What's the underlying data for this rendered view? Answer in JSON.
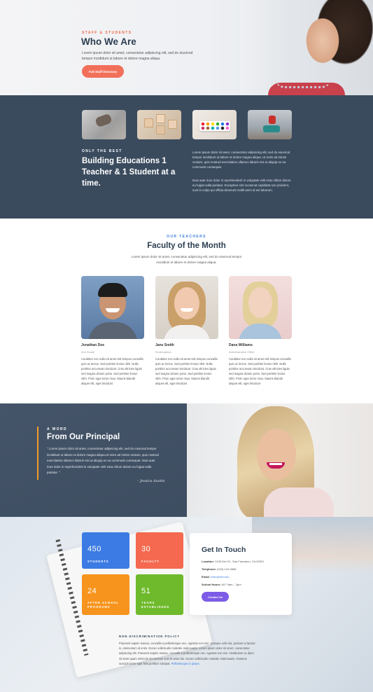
{
  "hero": {
    "eyebrow": "STAFF & STUDENTS",
    "title": "Who We Are",
    "text": "Lorem ipsum dolor sit amet, consectetur adipiscing elit, sed do eiusmod tempor incididunt ut labore et dolore magna aliqua.",
    "button": "Full Staff Directory"
  },
  "overview": {
    "eyebrow": "ONLY THE BEST",
    "title": "Building Educations 1 Teacher & 1 Student at a time.",
    "para1": "Lorem ipsum dolor sit amet, consectetur adipiscing elit, sed do eiusmod tempor incididunt ut labore et dolore magna aliqua. Ut enim ad minim veniam, quis nostrud exercitation ullamco laboris nisi ut aliquip ex ea commodo consequat.",
    "para2": "Duis aute irure dolor in reprehenderit in voluptate velit esse cillum dolore eu fugiat nulla pariatur. Excepteur sint occaecat cupidatat non proident, sunt in culpa qui officia deserunt mollit anim id est laborum."
  },
  "faculty": {
    "eyebrow": "OUR TEACHERS",
    "title": "Faculty of the Month",
    "intro": "Lorem ipsum dolor sit amet, consectetur adipiscing elit, sed do eiusmod tempor incididunt ut labore et dolore magna aliqua.",
    "members": [
      {
        "name": "Jonathan Doe",
        "role": "2nd Grade",
        "bio": "Curabitur non nulla sit amet nisl tempus convallis quis ac lectus. Sed porttitor lectus nibh. Nulla porttitor accumsan tincidunt. Cras ultricies ligula sed magna dictum porta. Sed porttitor lectus nibh. Proin eget tortor risus. Mauris blandit aliquet elit, eget tincidunt"
      },
      {
        "name": "Jane Smith",
        "role": "Kindergarten",
        "bio": "Curabitur non nulla sit amet nisl tempus convallis quis ac lectus. Sed porttitor lectus nibh. Nulla porttitor accumsan tincidunt. Cras ultricies ligula sed magna dictum porta. Sed porttitor lectus nibh. Proin eget tortor risus. Mauris blandit aliquet elit, eget tincidunt"
      },
      {
        "name": "Dana Williams",
        "role": "Administrative Office",
        "bio": "Curabitur non nulla sit amet nisl tempus convallis quis ac lectus. Sed porttitor lectus nibh. Nulla porttitor accumsan tincidunt. Cras ultricies ligula sed magna dictum porta. Sed porttitor lectus nibh. Proin eget tortor risus. Mauris blandit aliquet elit, eget tincidunt"
      }
    ]
  },
  "principal": {
    "eyebrow": "A WORD",
    "title": "From Our Principal",
    "quote": "\" Lorem ipsum dolor sit amet, consectetur adipiscing elit, sed do eiusmod tempor incididunt ut labore et dolore magna aliqua.Ut enim ad minim veniam, quis nostrud exercitation ullamco laboris nisi ut aliquip ex ea commodo consequat. Duis aute irure dolor in reprehenderit in voluptate velit esse cillum dolore eu fugiat nulla pariatur. \"",
    "signature": "– Jessica Austin"
  },
  "stats": [
    {
      "number": "450",
      "label": "STUDENTS",
      "color": "#3b7be3"
    },
    {
      "number": "30",
      "label": "FACULTY",
      "color": "#f4694f"
    },
    {
      "number": "24",
      "label": "AFTER SCHOOL PROGRAMS",
      "color": "#f7941d"
    },
    {
      "number": "51",
      "label": "YEARS ESTABLISHED",
      "color": "#6fba2c"
    }
  ],
  "contact": {
    "title": "Get In Touch",
    "location_label": "Location:",
    "location": "1245 Divi St., San Francisco, CA 92921",
    "phone_label": "Telephone:",
    "phone": "(415) 123-4568",
    "email_label": "Email:",
    "email": "hello@divi.edu",
    "hours_label": "School Hours:",
    "hours": "M-F 9am – 3pm",
    "button": "Contact Us"
  },
  "policy": {
    "heading": "NON-DISCRIMINATION POLICY",
    "text": "Praesent sapien massa, convallis a pellentesque nec, egestas non nisi. Quisque velit nisi, pretium ut lacinia in, elementum id enim. Donec sollicitudin molestie malesuada. Lorem ipsum dolor sit amet, consectetur adipiscing elit. Praesent sapien massa, convallis a pellentesque nec, egestas non nisi. Vestibulum ac diam sit amet quam vehicula elementum sed sit amet dui. Donec sollicitudin molestie malesuada. Vivamus suscipit tortor eget felis porttitor volutpat.",
    "link": "Pellentesque in ipsum."
  },
  "colors": {
    "accent_orange": "#f2705a",
    "dark": "#3b4b5e",
    "blue": "#3a7ee0",
    "purple": "#7c5ce6"
  }
}
